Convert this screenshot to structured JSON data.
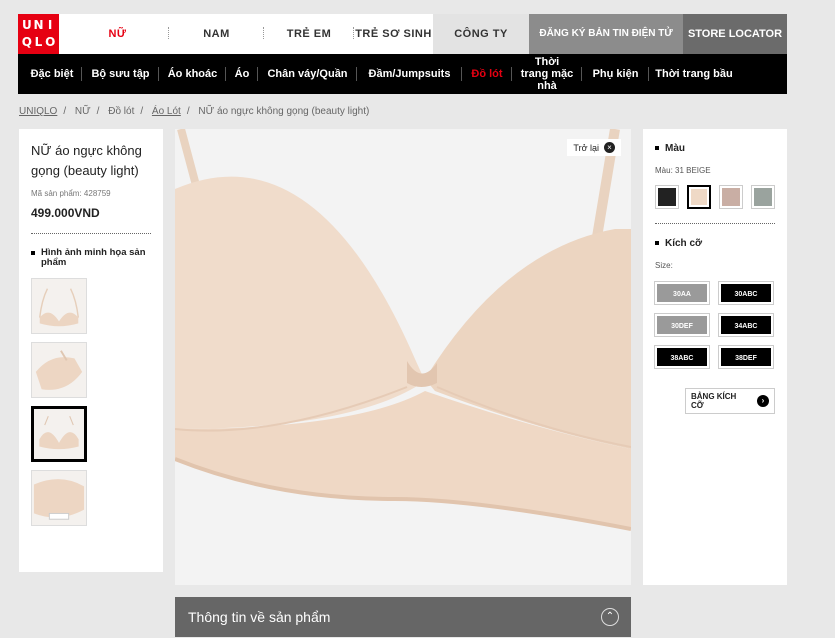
{
  "logo": {
    "lines": [
      "UNI",
      "QLO"
    ]
  },
  "top_nav": {
    "items": [
      {
        "label": "NỮ",
        "active": true
      },
      {
        "label": "NAM"
      },
      {
        "label": "TRẺ EM"
      },
      {
        "label": "TRẺ SƠ SINH"
      }
    ],
    "company": "CÔNG TY",
    "newsletter": "ĐĂNG KÝ BẢN TIN ĐIỆN TỬ",
    "store_locator": "STORE LOCATOR"
  },
  "sub_nav": {
    "items": [
      {
        "label": "Đặc biệt"
      },
      {
        "label": "Bộ sưu tập"
      },
      {
        "label": "Áo khoác"
      },
      {
        "label": "Áo"
      },
      {
        "label": "Chân váy/Quần"
      },
      {
        "label": "Đầm/Jumpsuits"
      },
      {
        "label": "Đồ lót",
        "highlight": true
      },
      {
        "label": "Thời trang mặc nhà"
      },
      {
        "label": "Phụ kiện"
      },
      {
        "label": "Thời trang bầu"
      }
    ]
  },
  "breadcrumb": [
    "UNIQLO",
    "NỮ",
    "Đồ lót",
    "Áo Lót",
    "NỮ áo ngực không gọng (beauty light)"
  ],
  "product": {
    "title": "NỮ áo ngực không gọng (beauty light)",
    "code_label": "Mã sản phẩm: 428759",
    "price": "499.000VND",
    "illustration_heading": "Hình ảnh minh họa sản phẩm"
  },
  "viewer": {
    "back_label": "Trở lại",
    "close_icon": "×"
  },
  "info_bar": {
    "label": "Thông tin về sản phẩm",
    "chevron": "⌃"
  },
  "options": {
    "color_heading": "Màu",
    "color_current": "Màu: 31 BEIGE",
    "colors": [
      {
        "hex": "#222222"
      },
      {
        "hex": "#efd9c6",
        "selected": true
      },
      {
        "hex": "#c9aea4"
      },
      {
        "hex": "#9aa39e"
      }
    ],
    "size_heading": "Kích cỡ",
    "size_label": "Size:",
    "sizes": [
      {
        "label": "30AA",
        "available": false
      },
      {
        "label": "30ABC",
        "available": true
      },
      {
        "label": "30DEF",
        "available": false
      },
      {
        "label": "34ABC",
        "available": true
      },
      {
        "label": "38ABC",
        "available": true
      },
      {
        "label": "38DEF",
        "available": true
      }
    ],
    "size_chart_label": "BẢNG KÍCH CỠ",
    "size_chart_arrow": "›"
  }
}
